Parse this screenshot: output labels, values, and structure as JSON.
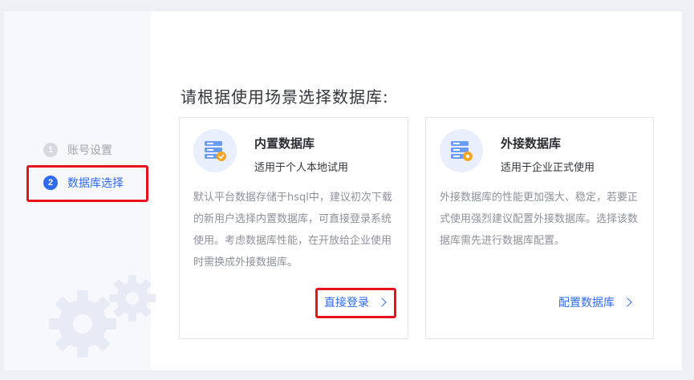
{
  "sidebar": {
    "steps": [
      {
        "num": "1",
        "label": "账号设置",
        "state": "done"
      },
      {
        "num": "2",
        "label": "数据库选择",
        "state": "active"
      }
    ]
  },
  "main": {
    "heading": "请根据使用场景选择数据库:",
    "cards": [
      {
        "title": "内置数据库",
        "subtitle": "适用于个人本地试用",
        "description": "默认平台数据存储于hsql中，建议初次下载的新用户选择内置数据库，可直接登录系统使用。考虑数据库性能，在开放给企业使用时需换成外接数据库。",
        "action": "直接登录",
        "icon": "database-check-icon"
      },
      {
        "title": "外接数据库",
        "subtitle": "适用于企业正式使用",
        "description": "外接数据库的性能更加强大、稳定，若要正式使用强烈建议配置外接数据库。选择该数据库需先进行数据库配置。",
        "action": "配置数据库",
        "icon": "database-gear-icon"
      }
    ]
  },
  "colors": {
    "accent": "#2f6bea",
    "highlight": "#e8121a",
    "muted_text": "#8c919b"
  }
}
